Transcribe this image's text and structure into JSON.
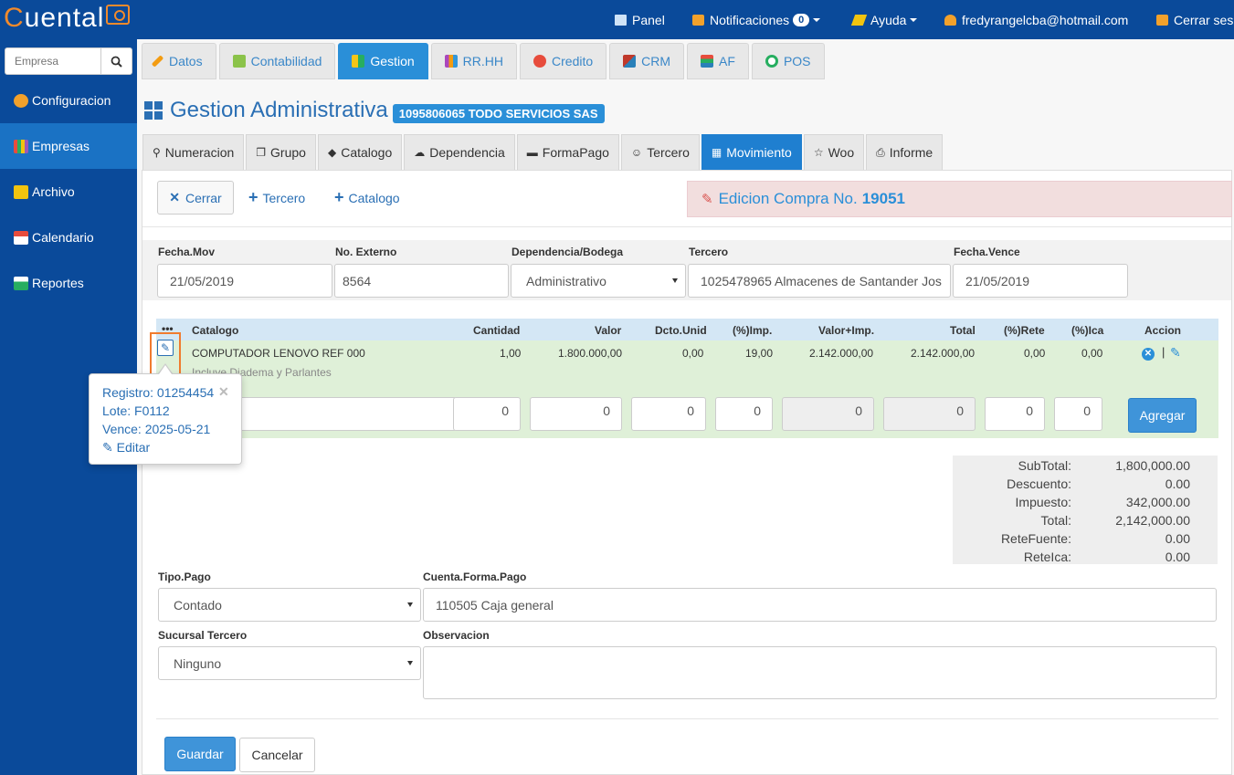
{
  "brand": {
    "logo_first": "C",
    "logo_rest": "uental"
  },
  "topbar": {
    "panel": "Panel",
    "notifications": "Notificaciones",
    "notifications_count": "0",
    "help": "Ayuda",
    "user": "fredyrangelcba@hotmail.com",
    "logout": "Cerrar ses"
  },
  "sidebar": {
    "search_placeholder": "Empresa",
    "items": [
      {
        "label": "Configuracion",
        "color": "#f2a12b"
      },
      {
        "label": "Empresas",
        "color": "#e84c3d"
      },
      {
        "label": "Archivo",
        "color": "#f1c40f"
      },
      {
        "label": "Calendario",
        "color": "#e74c3c"
      },
      {
        "label": "Reportes",
        "color": "#27ae60"
      }
    ]
  },
  "main_tabs": [
    {
      "label": "Datos",
      "color": "#f39c12"
    },
    {
      "label": "Contabilidad",
      "color": "#8bc34a"
    },
    {
      "label": "Gestion",
      "color": "#f5c518"
    },
    {
      "label": "RR.HH",
      "color": "#ab47bc"
    },
    {
      "label": "Credito",
      "color": "#e74c3c"
    },
    {
      "label": "CRM",
      "color": "#c0392b"
    },
    {
      "label": "AF",
      "color": "#e74c3c"
    },
    {
      "label": "POS",
      "color": "#27ae60"
    }
  ],
  "page": {
    "title": "Gestion Administrativa",
    "company": "1095806065 TODO SERVICIOS SAS"
  },
  "sub_tabs": [
    {
      "icon": "⚲",
      "label": "Numeracion"
    },
    {
      "icon": "❐",
      "label": "Grupo"
    },
    {
      "icon": "◆",
      "label": "Catalogo"
    },
    {
      "icon": "☁",
      "label": "Dependencia"
    },
    {
      "icon": "▬",
      "label": "FormaPago"
    },
    {
      "icon": "☺",
      "label": "Tercero"
    },
    {
      "icon": "▦",
      "label": "Movimiento"
    },
    {
      "icon": "☆",
      "label": "Woo"
    },
    {
      "icon": "⎙",
      "label": "Informe"
    }
  ],
  "toolbar": {
    "cerrar": "Cerrar",
    "tercero": "Tercero",
    "catalogo": "Catalogo",
    "edit_title": "Edicion Compra No.",
    "edit_number": "19051"
  },
  "form": {
    "fecha_mov_label": "Fecha.Mov",
    "fecha_mov": "21/05/2019",
    "no_externo_label": "No. Externo",
    "no_externo": "8564",
    "dependencia_label": "Dependencia/Bodega",
    "dependencia": "Administrativo",
    "tercero_label": "Tercero",
    "tercero": "1025478965 Almacenes de Santander Jos",
    "fecha_vence_label": "Fecha.Vence",
    "fecha_vence": "21/05/2019"
  },
  "grid": {
    "headers": {
      "more": "•••",
      "catalogo": "Catalogo",
      "cantidad": "Cantidad",
      "valor": "Valor",
      "dcto": "Dcto.Unid",
      "imp": "(%)Imp.",
      "valor_imp": "Valor+Imp.",
      "total": "Total",
      "rete": "(%)Rete",
      "ica": "(%)Ica",
      "accion": "Accion"
    },
    "row": {
      "catalogo": "COMPUTADOR LENOVO REF 000",
      "detalle": "Incluye Diadema y Parlantes",
      "cantidad": "1,00",
      "valor": "1.800.000,00",
      "dcto": "0,00",
      "imp": "19,00",
      "valor_imp": "2.142.000,00",
      "total": "2.142.000,00",
      "rete": "0,00",
      "ica": "0,00"
    },
    "inputs": {
      "cantidad": "0",
      "valor": "0",
      "dcto": "0",
      "imp": "0",
      "valor_imp": "0",
      "total": "0",
      "rete": "0",
      "ica": "0"
    },
    "agregar": "Agregar"
  },
  "popover": {
    "registro": "Registro: 01254454",
    "lote": "Lote: F0112",
    "vence": "Vence: 2025-05-21",
    "editar": "Editar"
  },
  "totals": {
    "subtotal_label": "SubTotal:",
    "subtotal": "1,800,000.00",
    "descuento_label": "Descuento:",
    "descuento": "0.00",
    "impuesto_label": "Impuesto:",
    "impuesto": "342,000.00",
    "total_label": "Total:",
    "total": "2,142,000.00",
    "retefuente_label": "ReteFuente:",
    "retefuente": "0.00",
    "reteica_label": "ReteIca:",
    "reteica": "0.00"
  },
  "payment": {
    "tipo_label": "Tipo.Pago",
    "tipo": "Contado",
    "cuenta_label": "Cuenta.Forma.Pago",
    "cuenta": "110505 Caja general",
    "sucursal_label": "Sucursal Tercero",
    "sucursal": "Ninguno",
    "observacion_label": "Observacion",
    "observacion": ""
  },
  "actions": {
    "guardar": "Guardar",
    "cancelar": "Cancelar"
  }
}
